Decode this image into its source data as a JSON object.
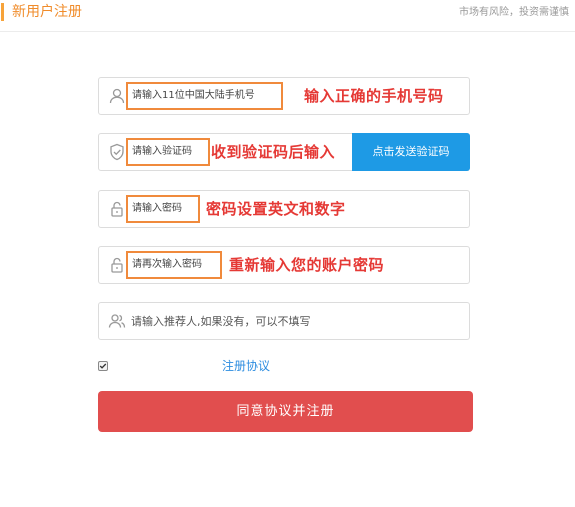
{
  "header": {
    "title": "新用户注册",
    "notice": "市场有风险，投资需谨慎",
    "accent_color": "#f7a33a"
  },
  "form": {
    "phone": {
      "placeholder": "请输入11位中国大陆手机号",
      "annotation": "输入正确的手机号码",
      "icon": "user-icon"
    },
    "code": {
      "placeholder": "请输入验证码",
      "annotation": "收到验证码后输入",
      "icon": "shield-icon",
      "send_button": "点击发送验证码"
    },
    "password": {
      "placeholder": "请输入密码",
      "annotation": "密码设置英文和数字",
      "icon": "lock-icon"
    },
    "confirm_password": {
      "placeholder": "请再次输入密码",
      "annotation": "重新输入您的账户密码",
      "icon": "lock-icon"
    },
    "referrer": {
      "placeholder": "请输入推荐人,如果没有，可以不填写",
      "icon": "users-icon"
    },
    "agreement": {
      "checked": true,
      "link_label": "注册协议"
    },
    "submit_label": "同意协议并注册"
  },
  "colors": {
    "highlight_border": "#f08a3c",
    "annotation_text": "#e53935",
    "send_button": "#1e9ae5",
    "submit_button": "#e14e4e",
    "link": "#2d8de0"
  }
}
